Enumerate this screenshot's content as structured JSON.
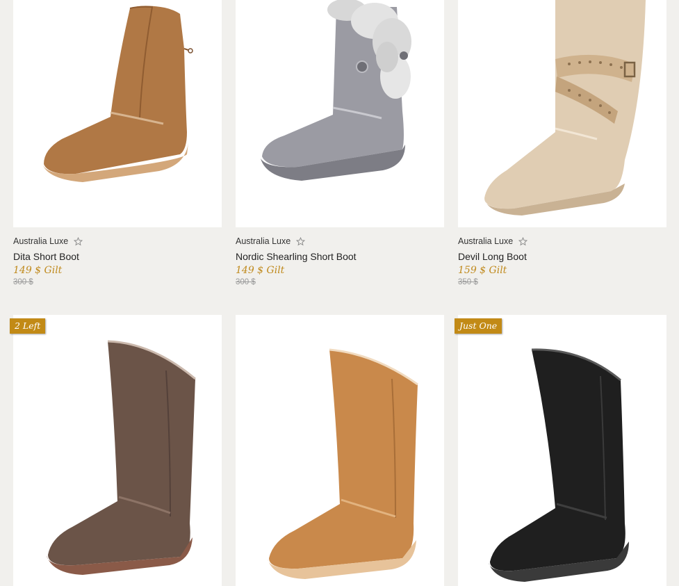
{
  "products": [
    {
      "brand": "Australia Luxe",
      "name": "Dita Short Boot",
      "price": "149 $ Gilt",
      "old_price": "300 $",
      "badge": "",
      "color": "#b07845"
    },
    {
      "brand": "Australia Luxe",
      "name": "Nordic Shearling Short Boot",
      "price": "149 $ Gilt",
      "old_price": "300 $",
      "badge": "",
      "color": "#9b9ba3"
    },
    {
      "brand": "Australia Luxe",
      "name": "Devil Long Boot",
      "price": "159 $ Gilt",
      "old_price": "350 $",
      "badge": "",
      "color": "#e0cdb3"
    },
    {
      "brand": "",
      "name": "",
      "price": "",
      "old_price": "",
      "badge": "2 Left",
      "color": "#6b5448"
    },
    {
      "brand": "",
      "name": "",
      "price": "",
      "old_price": "",
      "badge": "",
      "color": "#c9894b"
    },
    {
      "brand": "",
      "name": "",
      "price": "",
      "old_price": "",
      "badge": "Just One",
      "color": "#1f1f1f"
    }
  ],
  "icons": {
    "favorite": "star-outline-icon"
  },
  "colors": {
    "background": "#f1f0ed",
    "price": "#c08a1d",
    "badge": "#c28a16"
  }
}
